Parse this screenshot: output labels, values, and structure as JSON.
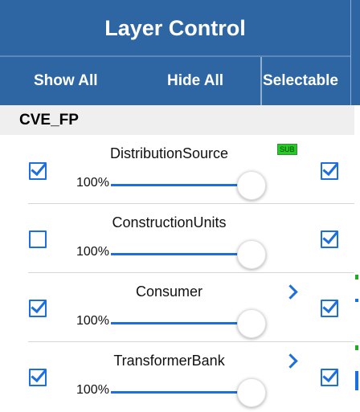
{
  "header": {
    "title": "Layer Control"
  },
  "toolbar": {
    "show_all": "Show All",
    "hide_all": "Hide All",
    "selectable": "Selectable"
  },
  "section": {
    "name": "CVE_FP"
  },
  "layers": [
    {
      "name": "DistributionSource",
      "opacity_label": "100%",
      "opacity": 1.0,
      "visible": true,
      "selectable": true,
      "badge": "SUB",
      "has_chevron": false
    },
    {
      "name": "ConstructionUnits",
      "opacity_label": "100%",
      "opacity": 1.0,
      "visible": false,
      "selectable": true,
      "badge": "",
      "has_chevron": false
    },
    {
      "name": "Consumer",
      "opacity_label": "100%",
      "opacity": 1.0,
      "visible": true,
      "selectable": true,
      "badge": "",
      "has_chevron": true
    },
    {
      "name": "TransformerBank",
      "opacity_label": "100%",
      "opacity": 1.0,
      "visible": true,
      "selectable": true,
      "badge": "",
      "has_chevron": true
    }
  ],
  "colors": {
    "header_bg": "#2d66a3",
    "accent": "#1b6fe0",
    "badge_bg": "#22cc22"
  },
  "icons": {
    "visible_checkbox": "checkbox-icon",
    "expand": "chevron-right-icon"
  }
}
